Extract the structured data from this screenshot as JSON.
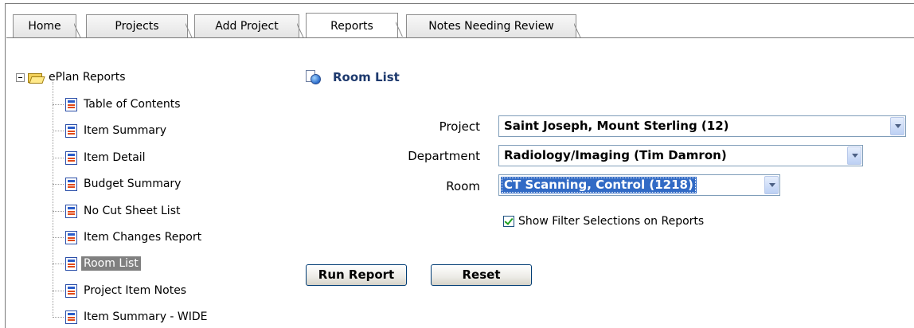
{
  "tabs": [
    {
      "label": "Home"
    },
    {
      "label": "Projects"
    },
    {
      "label": "Add Project"
    },
    {
      "label": "Reports",
      "active": true
    },
    {
      "label": "Notes Needing Review"
    }
  ],
  "tree": {
    "root_label": "ePlan Reports",
    "items": [
      {
        "label": "Table of Contents"
      },
      {
        "label": "Item Summary"
      },
      {
        "label": "Item Detail"
      },
      {
        "label": "Budget Summary"
      },
      {
        "label": "No Cut Sheet List"
      },
      {
        "label": "Item Changes Report"
      },
      {
        "label": "Room List",
        "selected": true
      },
      {
        "label": "Project Item Notes"
      },
      {
        "label": "Item Summary - WIDE"
      }
    ]
  },
  "panel": {
    "title": "Room List",
    "project_label": "Project",
    "project_value": "Saint Joseph, Mount Sterling (12)",
    "department_label": "Department",
    "department_value": "Radiology/Imaging (Tim Damron)",
    "room_label": "Room",
    "room_value": "CT Scanning, Control (1218)",
    "show_filter_label": "Show Filter Selections on Reports",
    "show_filter_checked": true,
    "run_report_label": "Run Report",
    "reset_label": "Reset"
  },
  "colors": {
    "title": "#1e3a6e",
    "selection": "#316ac5",
    "tree_selected": "#808080"
  }
}
